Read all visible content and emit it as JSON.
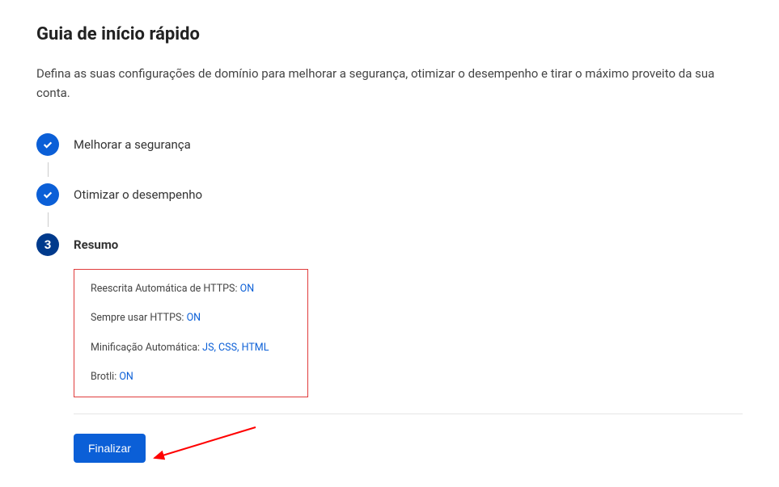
{
  "page": {
    "title": "Guia de início rápido",
    "description": "Defina as suas configurações de domínio para melhorar a segurança, otimizar o desempenho e tirar o máximo proveito da sua conta."
  },
  "steps": {
    "step1_label": "Melhorar a segurança",
    "step2_label": "Otimizar o desempenho",
    "step3_number": "3",
    "step3_label": "Resumo"
  },
  "summary": {
    "item1_label": "Reescrita Automática de HTTPS: ",
    "item1_value": "ON",
    "item2_label": "Sempre usar HTTPS: ",
    "item2_value": "ON",
    "item3_label": "Minificação Automática: ",
    "item3_value": "JS, CSS, HTML",
    "item4_label": "Brotli: ",
    "item4_value": "ON"
  },
  "button": {
    "finalize_label": "Finalizar"
  }
}
